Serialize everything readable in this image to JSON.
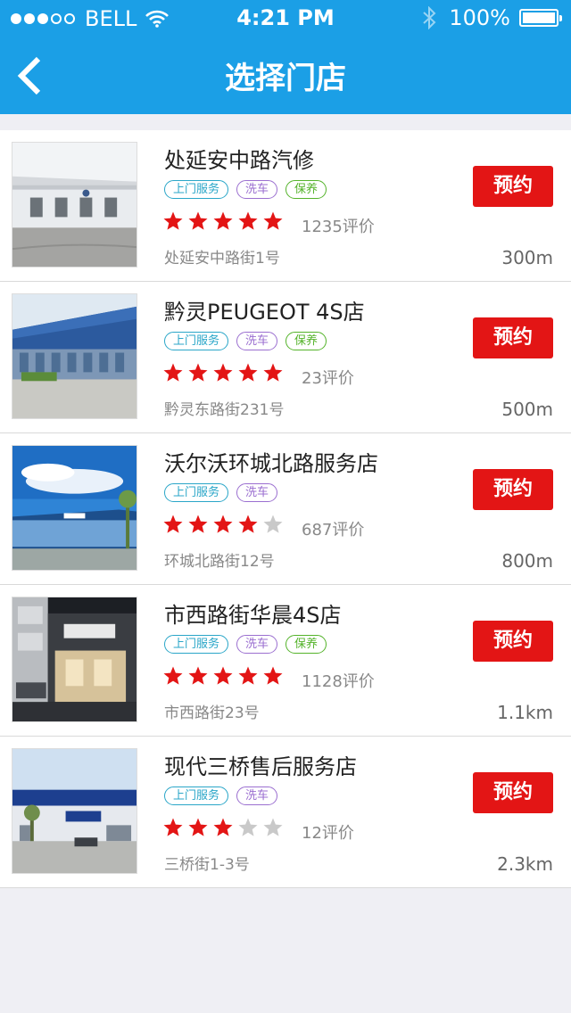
{
  "status_bar": {
    "carrier": "BELL",
    "signal_bars": 3,
    "signal_total": 5,
    "time": "4:21 PM",
    "battery": "100%"
  },
  "header": {
    "title": "选择门店"
  },
  "colors": {
    "header_bg": "#1b9fe6",
    "book_button": "#e31515",
    "star_on": "#e31515",
    "star_off": "#c9c9c9",
    "tag_door": "#2aa6c8",
    "tag_wash": "#9b6fd0",
    "tag_maint": "#54b32a"
  },
  "book_label": "预约",
  "stores": [
    {
      "name": "处延安中路汽修",
      "tags": [
        "上门服务",
        "洗车",
        "保养"
      ],
      "rating": 5,
      "reviews": "1235评价",
      "address": "处延安中路街1号",
      "distance": "300m"
    },
    {
      "name": "黔灵PEUGEOT 4S店",
      "tags": [
        "上门服务",
        "洗车",
        "保养"
      ],
      "rating": 5,
      "reviews": "23评价",
      "address": "黔灵东路街231号",
      "distance": "500m"
    },
    {
      "name": "沃尔沃环城北路服务店",
      "tags": [
        "上门服务",
        "洗车"
      ],
      "rating": 4,
      "reviews": "687评价",
      "address": "环城北路街12号",
      "distance": "800m"
    },
    {
      "name": "市西路街华晨4S店",
      "tags": [
        "上门服务",
        "洗车",
        "保养"
      ],
      "rating": 5,
      "reviews": "1128评价",
      "address": "市西路街23号",
      "distance": "1.1km"
    },
    {
      "name": "现代三桥售后服务店",
      "tags": [
        "上门服务",
        "洗车"
      ],
      "rating": 3,
      "reviews": "12评价",
      "address": "三桥街1-3号",
      "distance": "2.3km"
    }
  ]
}
